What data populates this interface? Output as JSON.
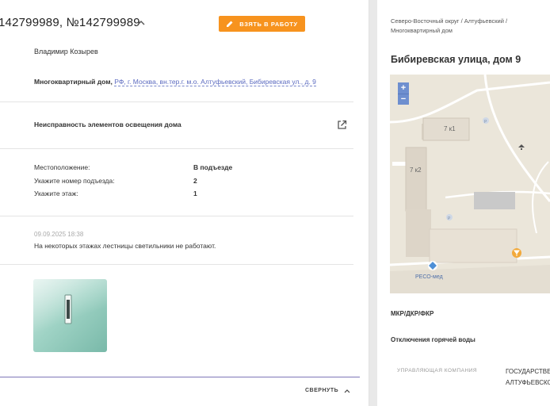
{
  "header": {
    "title": "142799989, №142799989",
    "take_button_label": "ВЗЯТЬ В РАБОТУ"
  },
  "request": {
    "person": "Владимир Козырев",
    "address_type": "Многоквартирный дом,",
    "address": "РФ, г. Москва, вн.тер.г. м.о. Алтуфьевский, Бибиревская ул., д. 9",
    "issue": "Неисправность элементов освещения дома",
    "fields": [
      {
        "label": "Местоположение:",
        "value": "В подъезде"
      },
      {
        "label": "Укажите номер подъезда:",
        "value": "2"
      },
      {
        "label": "Укажите этаж:",
        "value": "1"
      }
    ],
    "comment_time": "09.09.2025 18:38",
    "comment_text": "На некоторых этажах лестницы светильники не работают.",
    "collapse_label": "СВЕРНУТЬ"
  },
  "side": {
    "breadcrumb": "Северо-Восточный округ / Алтуфьевский / Многоквартирный дом",
    "title": "Бибиревская улица, дом 9",
    "map": {
      "zoom_in": "+",
      "zoom_out": "−",
      "building_1": "7 к1",
      "building_2": "7 к2",
      "poi": "РЕСО-мед",
      "parking": "P"
    },
    "section_1": "МКР/ДКР/ФКР",
    "section_2": "Отключения горячей воды",
    "col_a": "УПРАВЛЯЮЩАЯ КОМПАНИЯ",
    "col_b_1": "ГОСУДАРСТВЕННОЕ",
    "col_b_2": "АЛТУФЬЕВСКОГО"
  },
  "colors": {
    "accent": "#f7931e",
    "link": "#5c6bc0",
    "underline": "#7e76b8"
  }
}
